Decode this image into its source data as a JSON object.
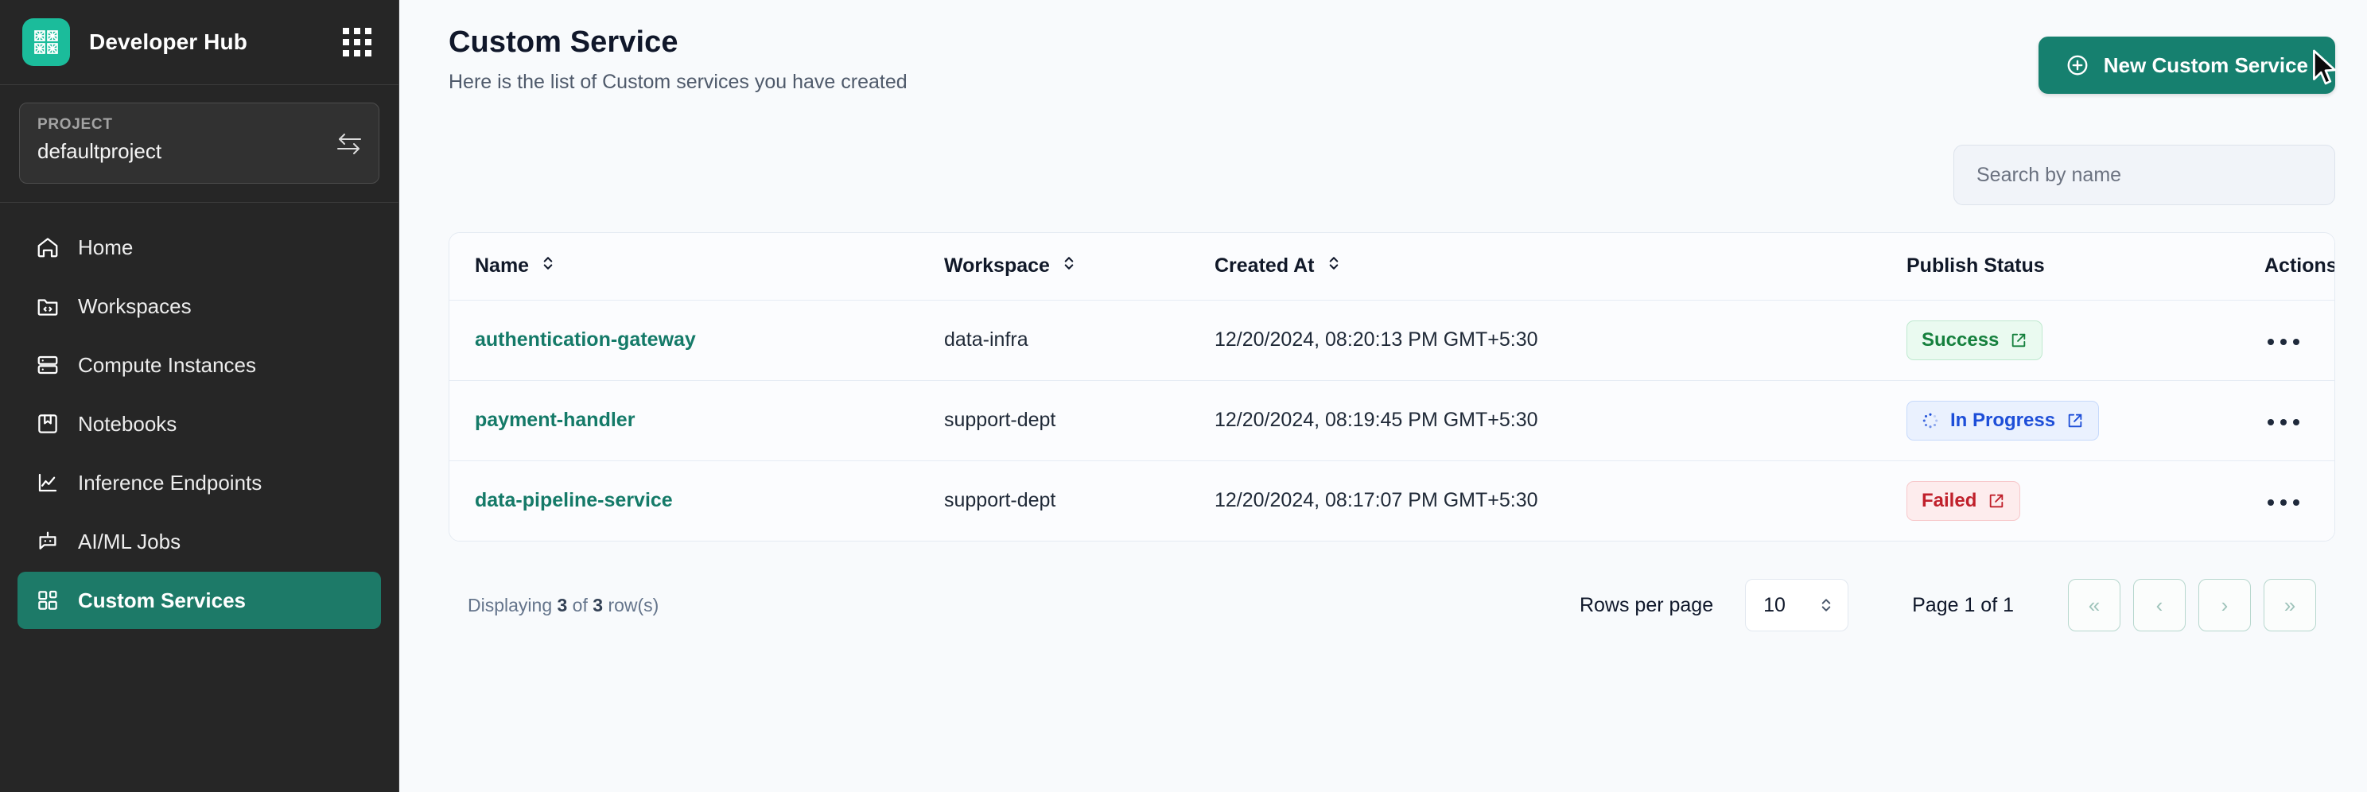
{
  "sidebar": {
    "brand": "Developer Hub",
    "apps_icon": "grid-apps-icon",
    "project": {
      "label": "PROJECT",
      "value": "defaultproject",
      "switch_icon": "switch-arrows-icon"
    },
    "items": [
      {
        "label": "Home",
        "icon": "home-icon",
        "active": false
      },
      {
        "label": "Workspaces",
        "icon": "folder-code-icon",
        "active": false
      },
      {
        "label": "Compute Instances",
        "icon": "server-icon",
        "active": false
      },
      {
        "label": "Notebooks",
        "icon": "notebook-icon",
        "active": false
      },
      {
        "label": "Inference Endpoints",
        "icon": "line-chart-icon",
        "active": false
      },
      {
        "label": "AI/ML Jobs",
        "icon": "robot-icon",
        "active": false
      },
      {
        "label": "Custom Services",
        "icon": "blocks-icon",
        "active": true
      }
    ]
  },
  "header": {
    "title": "Custom Service",
    "subtitle": "Here is the list of Custom services you have created",
    "new_button": {
      "label": "New Custom Service",
      "icon": "plus-circle-icon"
    }
  },
  "search": {
    "placeholder": "Search by name",
    "value": ""
  },
  "table": {
    "columns": [
      {
        "label": "Name",
        "sortable": true
      },
      {
        "label": "Workspace",
        "sortable": true
      },
      {
        "label": "Created At",
        "sortable": true
      },
      {
        "label": "Publish Status",
        "sortable": false
      },
      {
        "label": "Actions",
        "sortable": false
      }
    ],
    "rows": [
      {
        "name": "authentication-gateway",
        "workspace": "data-infra",
        "created_at": "12/20/2024, 08:20:13 PM GMT+5:30",
        "status": {
          "label": "Success",
          "kind": "success",
          "icon": "external-link-icon"
        },
        "actions_icon": "more-horizontal-icon"
      },
      {
        "name": "payment-handler",
        "workspace": "support-dept",
        "created_at": "12/20/2024, 08:19:45 PM GMT+5:30",
        "status": {
          "label": "In Progress",
          "kind": "progress",
          "icon": "external-link-icon",
          "leading_icon": "spinner-icon"
        },
        "actions_icon": "more-horizontal-icon"
      },
      {
        "name": "data-pipeline-service",
        "workspace": "support-dept",
        "created_at": "12/20/2024, 08:17:07 PM GMT+5:30",
        "status": {
          "label": "Failed",
          "kind": "failed",
          "icon": "external-link-icon"
        },
        "actions_icon": "more-horizontal-icon"
      }
    ]
  },
  "footer": {
    "displaying_prefix": "Displaying ",
    "displaying_count": "3",
    "displaying_mid": " of ",
    "displaying_total": "3",
    "displaying_suffix": " row(s)",
    "rows_per_page_label": "Rows per page",
    "rows_per_page_value": "10",
    "page_indicator": "Page 1 of 1",
    "pager": {
      "first": "«",
      "prev": "‹",
      "next": "›",
      "last": "»"
    }
  },
  "colors": {
    "brand_teal": "#16806f",
    "sidebar_bg": "#262626",
    "active_nav": "#1d7a68",
    "link": "#147a68",
    "success": "#15803d",
    "progress": "#1d4ed8",
    "failed": "#c0202b",
    "page_bg": "#f8fafc"
  }
}
